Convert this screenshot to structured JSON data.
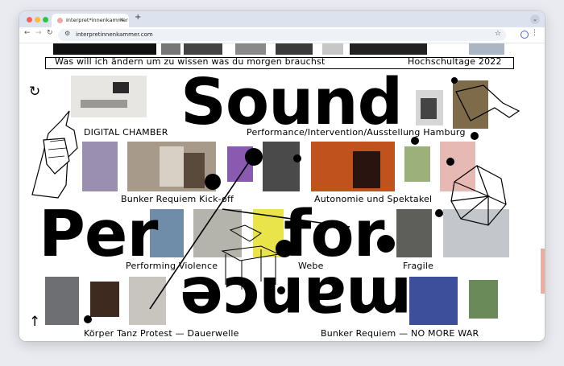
{
  "browser": {
    "tab_title": "Interpret*innenkammer",
    "url": "interpretinnenkammer.com",
    "icons": [
      "reload-icon",
      "back-icon",
      "forward-icon",
      "bookmark-star-icon",
      "profile-icon",
      "menu-icon"
    ]
  },
  "page": {
    "words": {
      "sound": "Sound",
      "per": "Per",
      "for": "for",
      "mance": "mance"
    },
    "labels": {
      "marquee": "Was will ich ändern um zu wissen was du morgen brauchst",
      "hochschultage": "Hochschultage 2022",
      "digital_chamber": "DIGITAL CHAMBER",
      "performance_ausstellung": "Performance/Intervention/Ausstellung Hamburg",
      "bunker_kickoff": "Bunker Requiem Kick-off",
      "autonomie": "Autonomie und Spektakel",
      "performing_violence": "Performing Violence",
      "webe": "Webe",
      "fragile": "Fragile",
      "koerper": "Körper Tanz Protest — Dauerwelle",
      "no_more_war": "Bunker Requiem — NO MORE WAR"
    },
    "colors": {
      "ink": "#000000",
      "accent": "#f4a9a0",
      "tab_strip": "#dde3ee"
    }
  }
}
